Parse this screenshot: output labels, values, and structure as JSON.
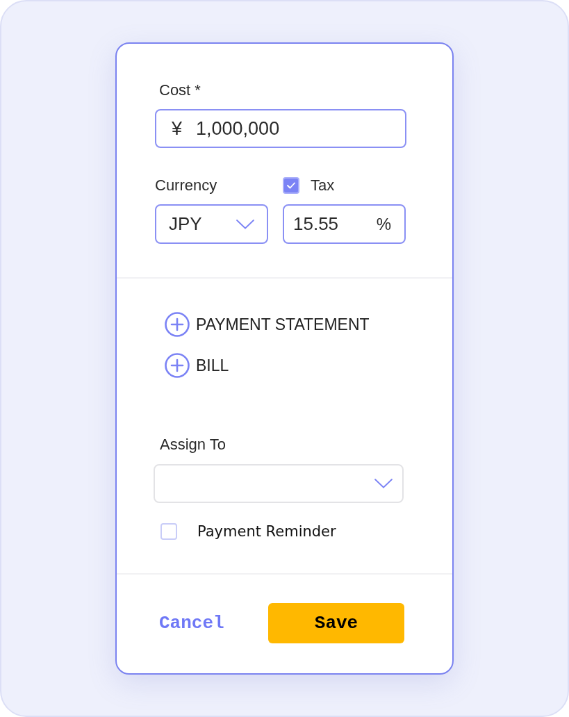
{
  "cost": {
    "label": "Cost *",
    "currency_symbol": "¥",
    "value": "1,000,000"
  },
  "currency": {
    "label": "Currency",
    "value": "JPY"
  },
  "tax": {
    "label": "Tax",
    "checked": true,
    "value": "15.55",
    "unit": "%"
  },
  "attachments": [
    {
      "label": "PAYMENT STATEMENT"
    },
    {
      "label": "BILL"
    }
  ],
  "assign_to": {
    "label": "Assign To"
  },
  "payment_reminder": {
    "label": "Payment Reminder",
    "checked": false
  },
  "buttons": {
    "cancel": "Cancel",
    "save": "Save"
  }
}
